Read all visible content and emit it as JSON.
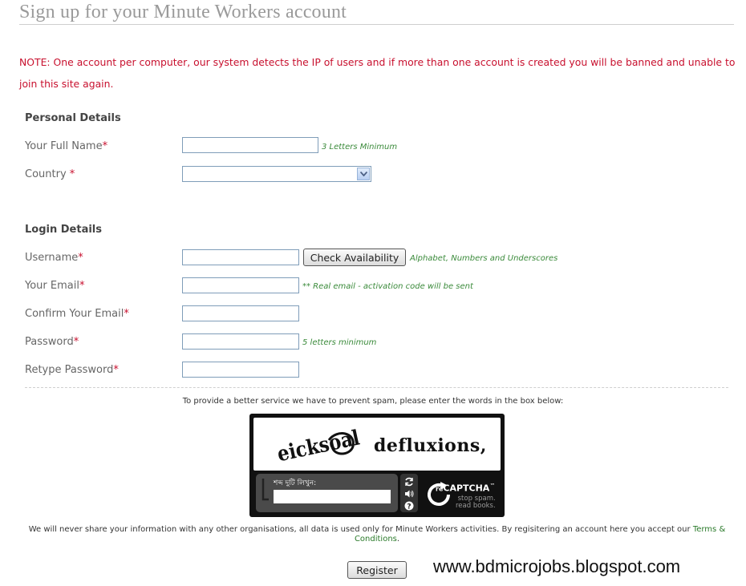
{
  "page": {
    "title": "Sign up for your Minute Workers account",
    "notice": "NOTE: One account per computer, our system detects the IP of users and if more than one account is created you will be banned and unable to join this site again."
  },
  "personal": {
    "heading": "Personal Details",
    "full_name": {
      "label": "Your Full Name",
      "required_mark": "*",
      "value": "",
      "hint": "3 Letters Minimum"
    },
    "country": {
      "label": "Country",
      "required_mark": " *",
      "selected": ""
    }
  },
  "login": {
    "heading": "Login Details",
    "username": {
      "label": "Username",
      "required_mark": "*",
      "value": "",
      "check_button": "Check Availability",
      "hint": "Alphabet, Numbers and Underscores"
    },
    "email": {
      "label": "Your Email",
      "required_mark": "*",
      "value": "",
      "hint": "** Real email - activation code will be sent"
    },
    "confirm_email": {
      "label": "Confirm Your Email",
      "required_mark": "*",
      "value": ""
    },
    "password": {
      "label": "Password",
      "required_mark": "*",
      "value": "",
      "hint": "5 letters minimum"
    },
    "retype_password": {
      "label": "Retype Password",
      "required_mark": "*",
      "value": ""
    }
  },
  "captcha": {
    "instruction": "To provide a better service we have to prevent spam, please enter the words in the box below:",
    "word_distorted": "eicksoal",
    "word_clear": "defluxions,",
    "entry_label": "শব্দ দুটি লিখুন:",
    "entry_value": "",
    "brand": {
      "re": "re",
      "name": "CAPTCHA",
      "tm": "™"
    },
    "tagline_line1": "stop spam.",
    "tagline_line2": "read books.",
    "icons": [
      "refresh-icon",
      "audio-icon",
      "help-icon"
    ]
  },
  "footer": {
    "privacy_text": "We will never share your information with any other organisations, all data is used only for Minute Workers activities. By regisitering an account here you accept our ",
    "terms_link": "Terms & Conditions",
    "privacy_end": ".",
    "register_button": "Register"
  },
  "watermark": "www.bdmicrojobs.blogspot.com",
  "colors": {
    "notice": "#c8102e",
    "hint": "#3a8a3a",
    "title": "#9a9a9a",
    "input_border": "#7f9db9"
  }
}
